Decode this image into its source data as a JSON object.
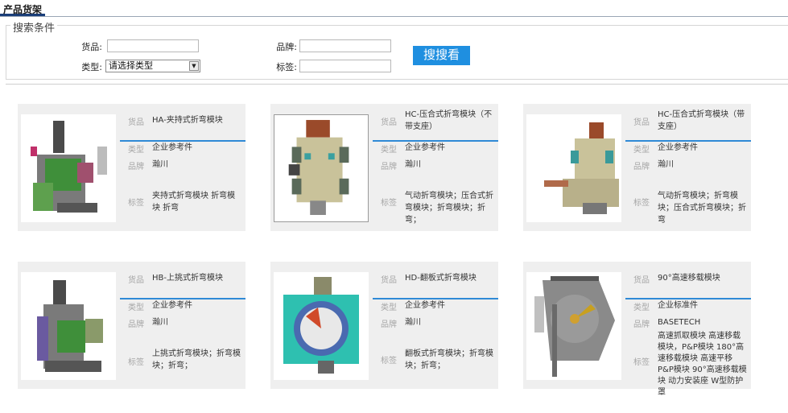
{
  "header": {
    "tab_label": "产品货架"
  },
  "search": {
    "legend": "搜索条件",
    "product_label": "货品:",
    "type_label": "类型:",
    "type_selected": "请选择类型",
    "brand_label": "品牌:",
    "tag_label": "标签:",
    "button_label": "搜搜看"
  },
  "field_labels": {
    "product": "货品",
    "type": "类型",
    "brand": "品牌",
    "tags": "标签"
  },
  "products": [
    {
      "name": "HA-夹持式折弯模块",
      "type": "企业参考件",
      "brand": "瀚川",
      "tags": "夹持式折弯模块 折弯模块 折弯"
    },
    {
      "name": "HC-压合式折弯模块（不带支座）",
      "type": "企业参考件",
      "brand": "瀚川",
      "tags": "气动折弯模块；压合式折弯模块；折弯模块；折弯；"
    },
    {
      "name": "HC-压合式折弯模块（带支座）",
      "type": "企业参考件",
      "brand": "瀚川",
      "tags": "气动折弯模块；折弯模块；压合式折弯模块；折弯"
    },
    {
      "name": "HB-上挑式折弯模块",
      "type": "企业参考件",
      "brand": "瀚川",
      "tags": "上挑式折弯模块；折弯模块；折弯；"
    },
    {
      "name": "HD-翻板式折弯模块",
      "type": "企业参考件",
      "brand": "瀚川",
      "tags": "翻板式折弯模块；折弯模块；折弯；"
    },
    {
      "name": "90°高速移载模块",
      "type": "企业标准件",
      "brand": "BASETECH",
      "tags": "高速抓取模块 高速移载模块，P&P模块 180°高速移载模块 高速平移P&P模块 90°高速移载模块 动力安装座 W型防护罩"
    }
  ]
}
